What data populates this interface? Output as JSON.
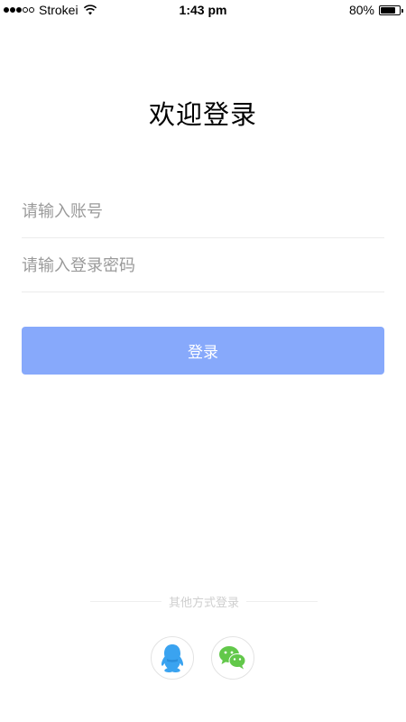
{
  "status_bar": {
    "carrier": "Strokei",
    "time": "1:43 pm",
    "battery": "80%",
    "battery_level": 0.8,
    "signal_bars_filled": 3,
    "signal_bars_total": 5
  },
  "title": "欢迎登录",
  "account_input": {
    "placeholder": "请输入账号",
    "value": ""
  },
  "password_input": {
    "placeholder": "请输入登录密码",
    "value": ""
  },
  "login_button": {
    "label": "登录",
    "color": "#87a9fb"
  },
  "other_login": {
    "label": "其他方式登录",
    "methods": [
      {
        "icon": "qq-icon",
        "color": "#3aa3f0"
      },
      {
        "icon": "wechat-icon",
        "color": "#62c84a"
      }
    ]
  }
}
